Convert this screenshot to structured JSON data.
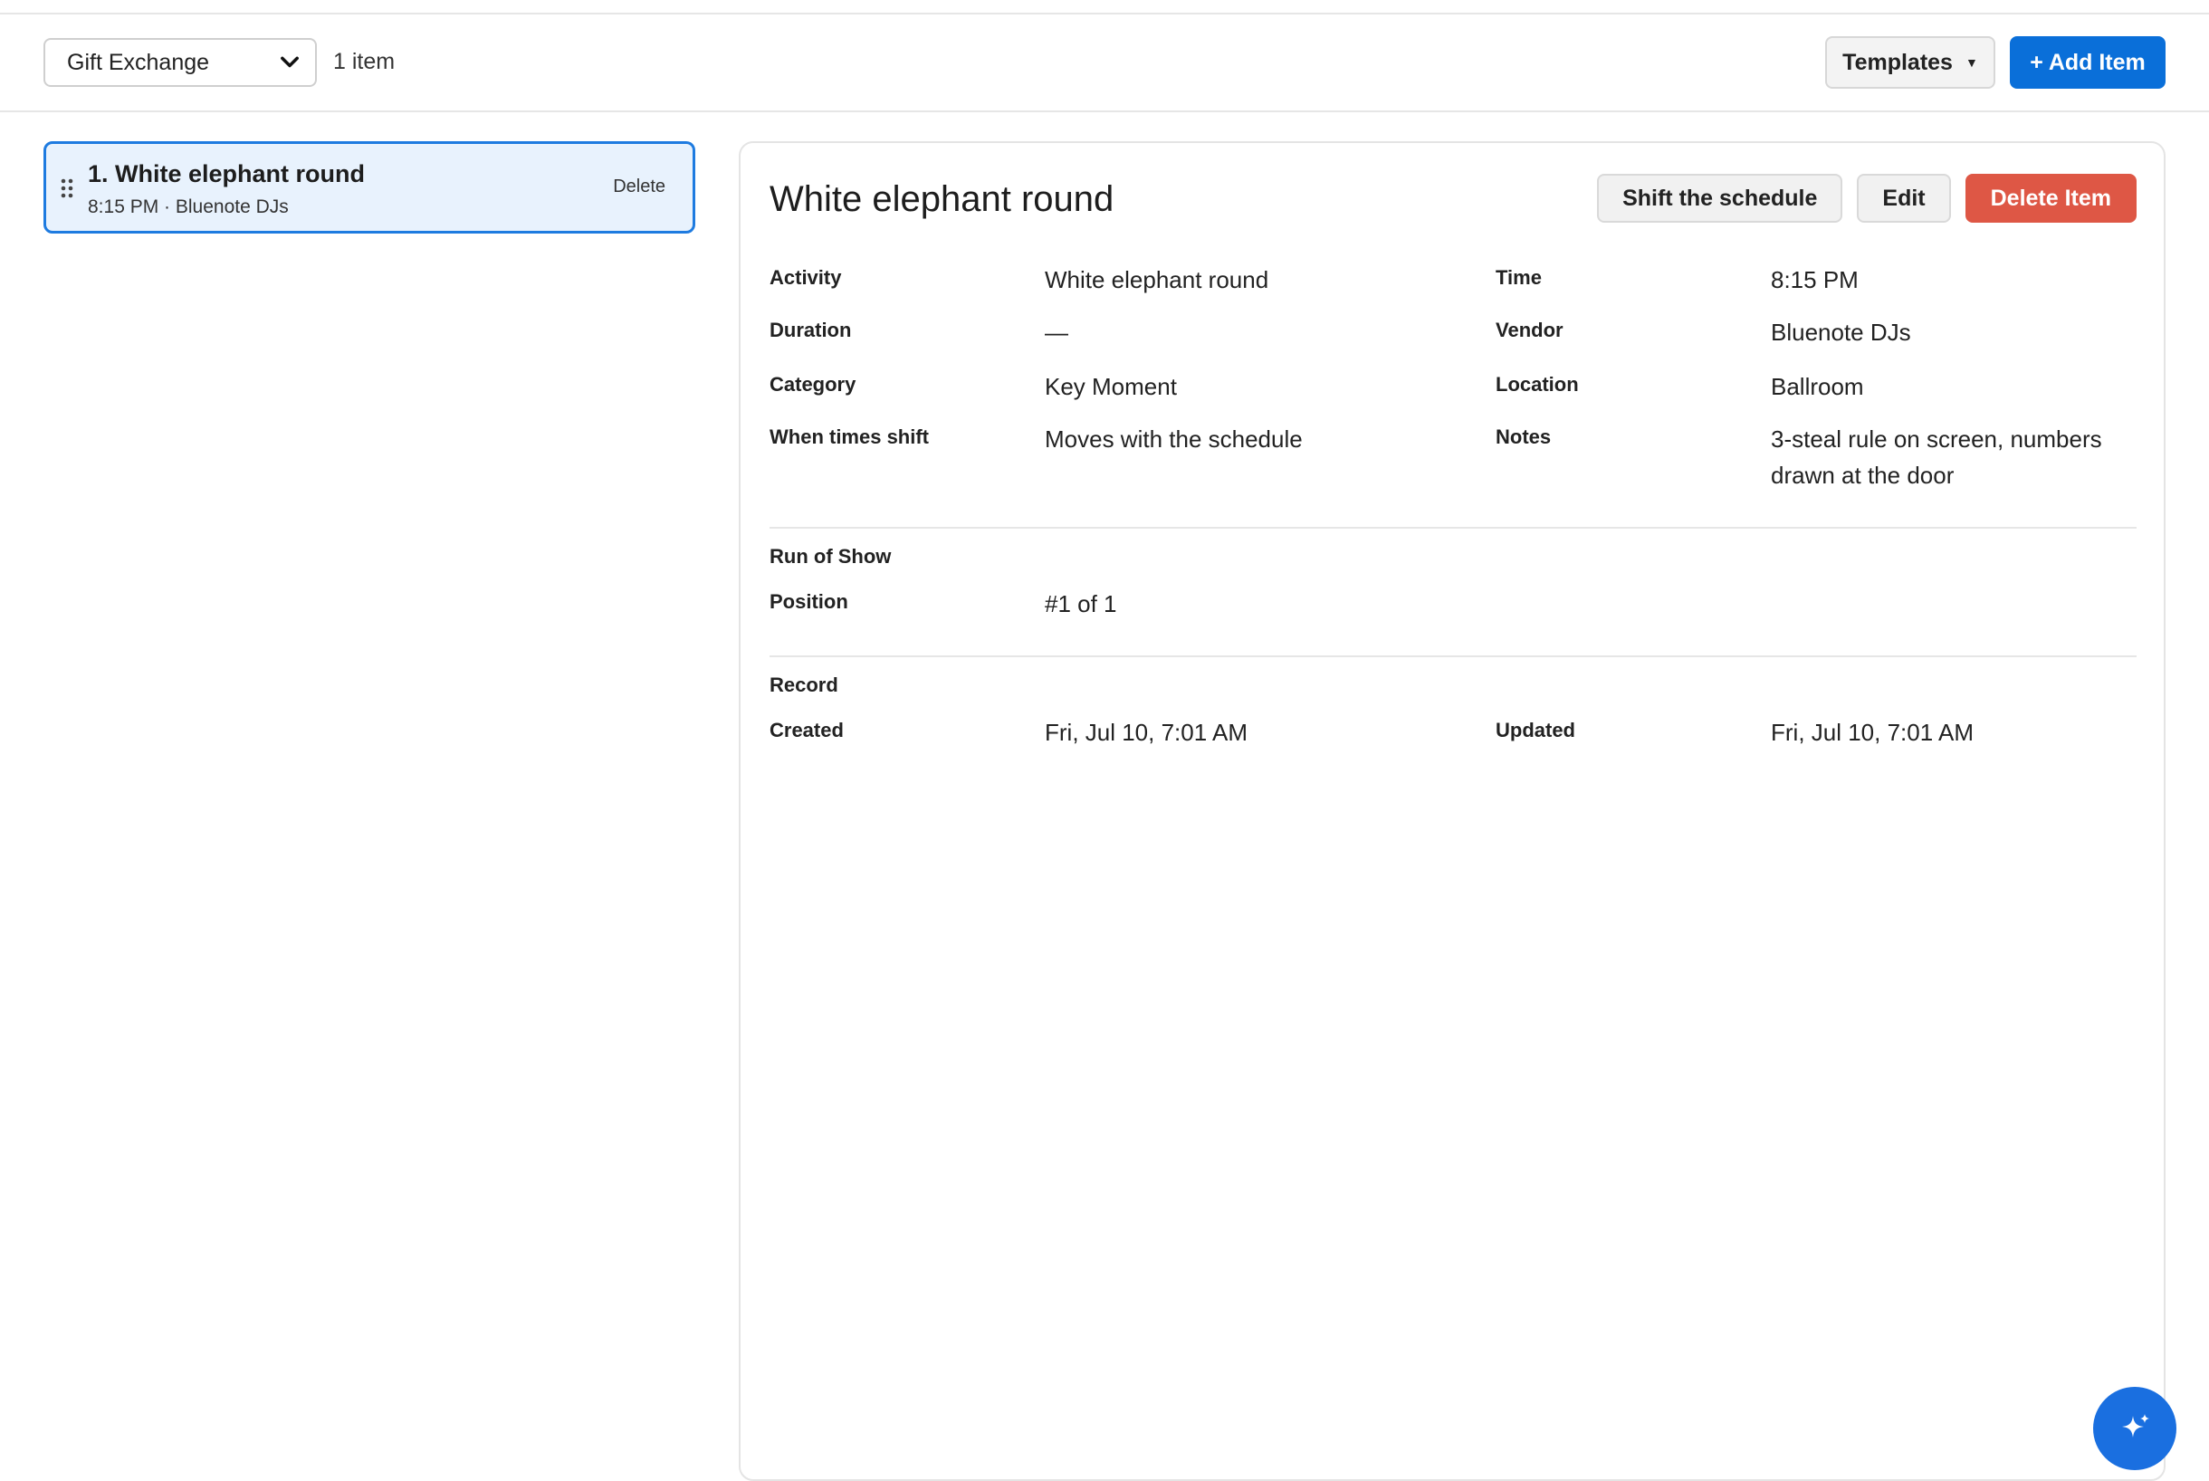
{
  "toolbar": {
    "selected_list": "Gift Exchange",
    "item_count": "1 item",
    "templates_label": "Templates",
    "add_item_label": "+ Add Item"
  },
  "items": [
    {
      "title": "1. White elephant round",
      "subtitle": "8:15 PM · Bluenote DJs",
      "delete_label": "Delete"
    }
  ],
  "detail": {
    "title": "White elephant round",
    "shift_label": "Shift the schedule",
    "edit_label": "Edit",
    "delete_label": "Delete Item",
    "fields": {
      "activity_label": "Activity",
      "activity": "White elephant round",
      "time_label": "Time",
      "time": "8:15 PM",
      "duration_label": "Duration",
      "duration": "—",
      "vendor_label": "Vendor",
      "vendor": "Bluenote DJs",
      "category_label": "Category",
      "category": "Key Moment",
      "location_label": "Location",
      "location": "Ballroom",
      "shift_rule_label": "When times shift",
      "shift_rule": "Moves with the schedule",
      "notes_label": "Notes",
      "notes_line1": "3-steal rule on screen, numbers",
      "notes_line2": "drawn at the door"
    },
    "run_of_show": {
      "heading": "Run of Show",
      "position_label": "Position",
      "position": "#1 of 1"
    },
    "record": {
      "heading": "Record",
      "created_label": "Created",
      "created": "Fri, Jul 10, 7:01 AM",
      "updated_label": "Updated",
      "updated": "Fri, Jul 10, 7:01 AM"
    }
  },
  "icons": {
    "chevron": "chevron-down-icon",
    "grip": "drag-handle-icon",
    "fab": "sparkle-icon"
  },
  "colors": {
    "accent": "#0a6fd9",
    "danger": "#de5745",
    "selected_bg": "#e8f2fd"
  }
}
